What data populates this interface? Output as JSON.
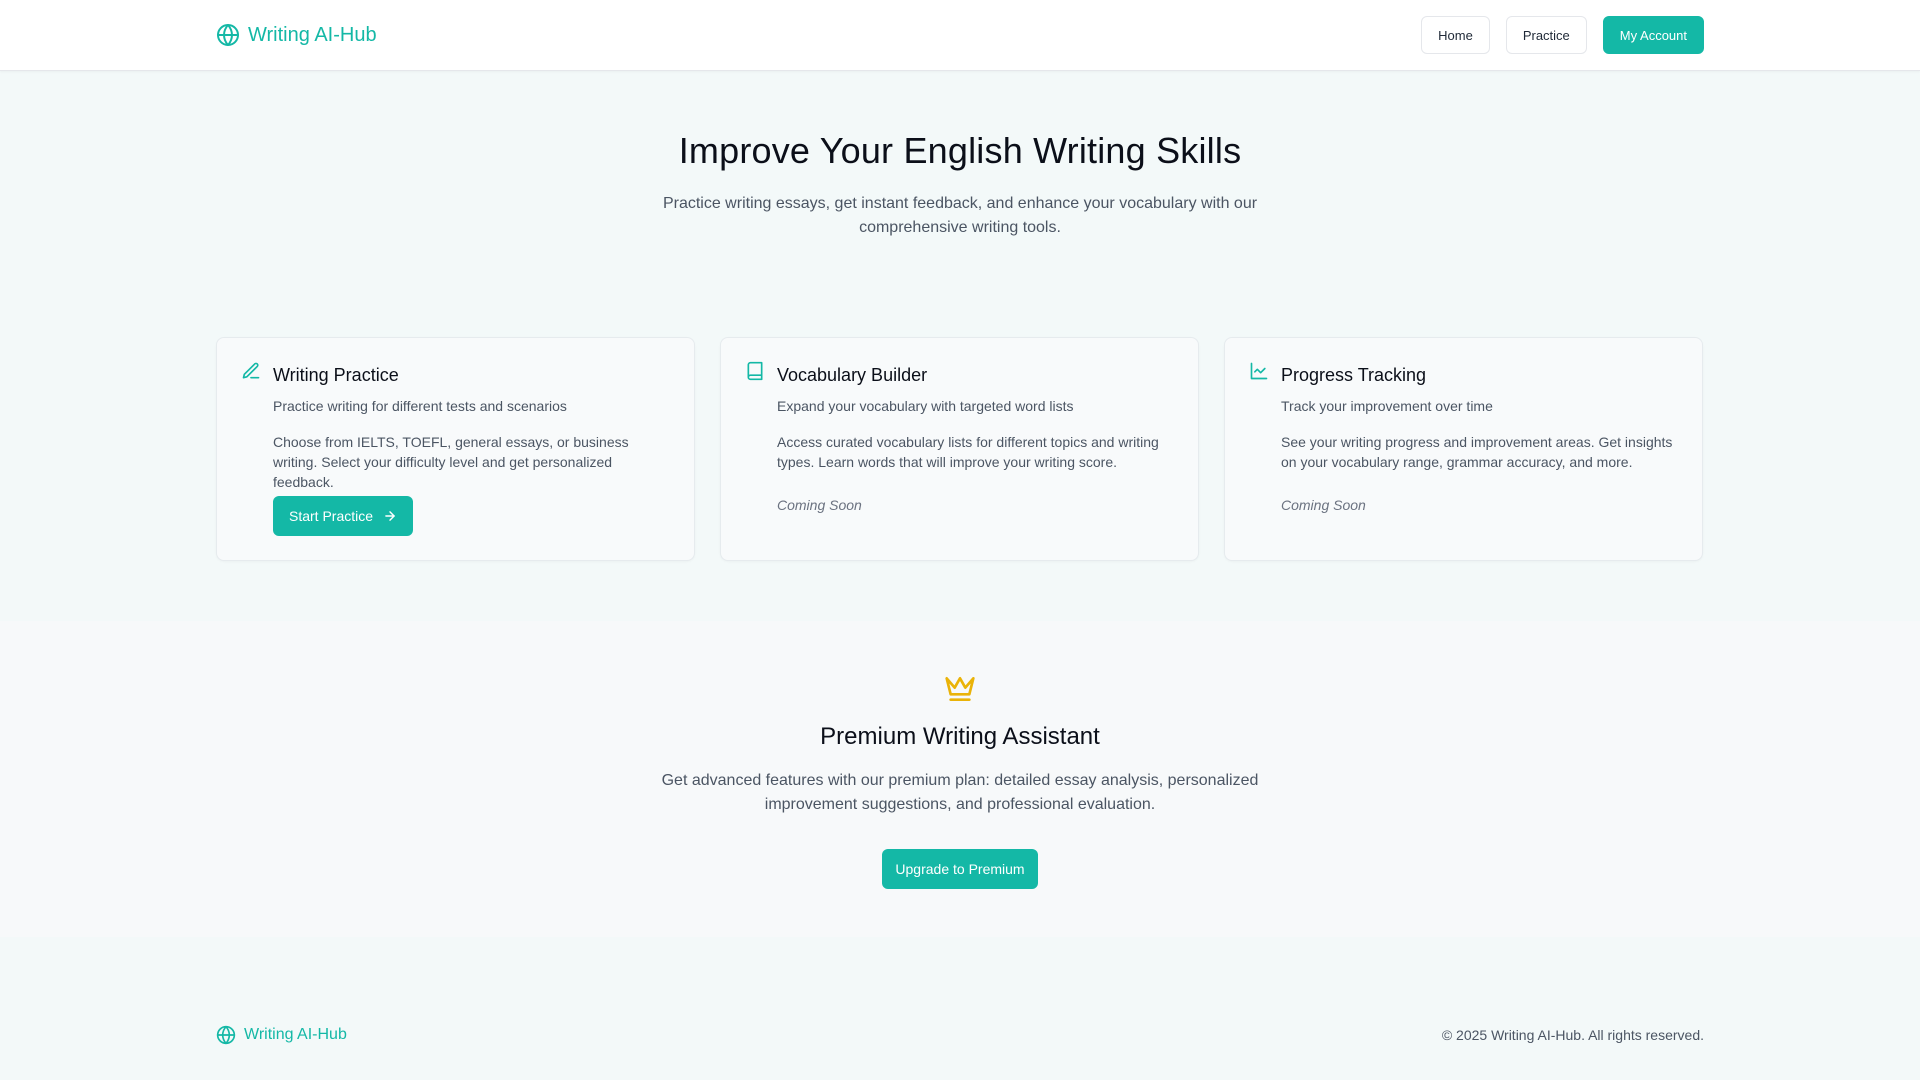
{
  "brand": {
    "name": "Writing AI-Hub",
    "accent_color": "#14b8a6",
    "icon": "globe-icon"
  },
  "nav": {
    "home": "Home",
    "practice": "Practice",
    "account": "My Account"
  },
  "hero": {
    "title": "Improve Your English Writing Skills",
    "subtitle": "Practice writing essays, get instant feedback, and enhance your vocabulary with our comprehensive writing tools."
  },
  "cards": [
    {
      "icon": "pencil-icon",
      "title": "Writing Practice",
      "subtitle": "Practice writing for different tests and scenarios",
      "description": "Choose from IELTS, TOEFL, general essays, or business writing. Select your difficulty level and get personalized feedback.",
      "action": "Start Practice"
    },
    {
      "icon": "book-icon",
      "title": "Vocabulary Builder",
      "subtitle": "Expand your vocabulary with targeted word lists",
      "description": "Access curated vocabulary lists for different topics and writing types. Learn words that will improve your writing score.",
      "status": "Coming Soon"
    },
    {
      "icon": "line-chart-icon",
      "title": "Progress Tracking",
      "subtitle": "Track your improvement over time",
      "description": "See your writing progress and improvement areas. Get insights on your vocabulary range, grammar accuracy, and more.",
      "status": "Coming Soon"
    }
  ],
  "premium": {
    "icon": "crown-icon",
    "icon_color": "#eab308",
    "title": "Premium Writing Assistant",
    "description": "Get advanced features with our premium plan: detailed essay analysis, personalized improvement suggestions, and professional evaluation.",
    "button": "Upgrade to Premium"
  },
  "footer": {
    "brand": "Writing AI-Hub",
    "copyright": "© 2025 Writing AI-Hub. All rights reserved."
  }
}
